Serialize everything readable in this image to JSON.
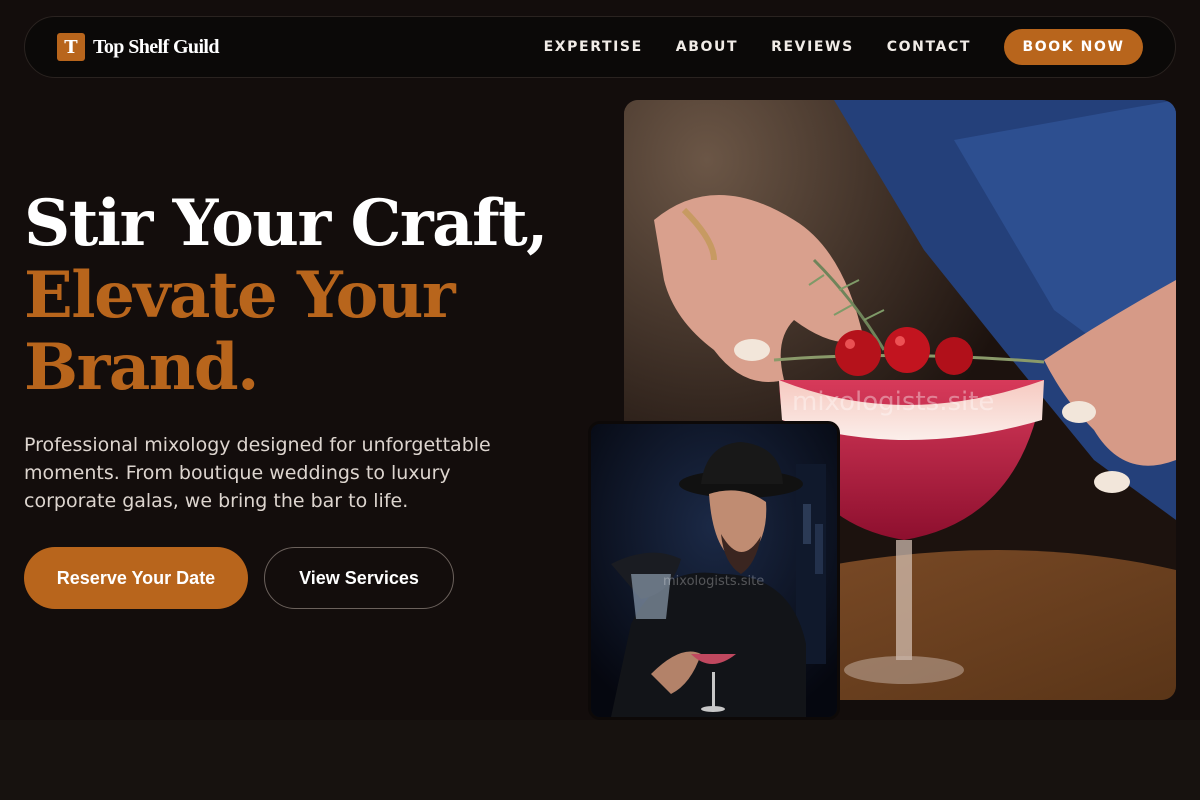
{
  "nav": {
    "brand_mark": "T",
    "brand_name": "Top Shelf Guild",
    "links": [
      "EXPERTISE",
      "ABOUT",
      "REVIEWS",
      "CONTACT"
    ],
    "cta": "BOOK NOW"
  },
  "hero": {
    "title_line1": "Stir Your Craft,",
    "title_line2": "Elevate Your Brand.",
    "subtitle": "Professional mixology designed for unforgettable moments. From boutique weddings to luxury corporate galas, we bring the bar to life.",
    "primary_button": "Reserve Your Date",
    "secondary_button": "View Services"
  },
  "images": {
    "main_watermark": "mixologists.site",
    "inset_watermark": "mixologists.site"
  },
  "colors": {
    "accent": "#b8651c",
    "background": "#130d0c",
    "nav_background": "#0b0908"
  }
}
